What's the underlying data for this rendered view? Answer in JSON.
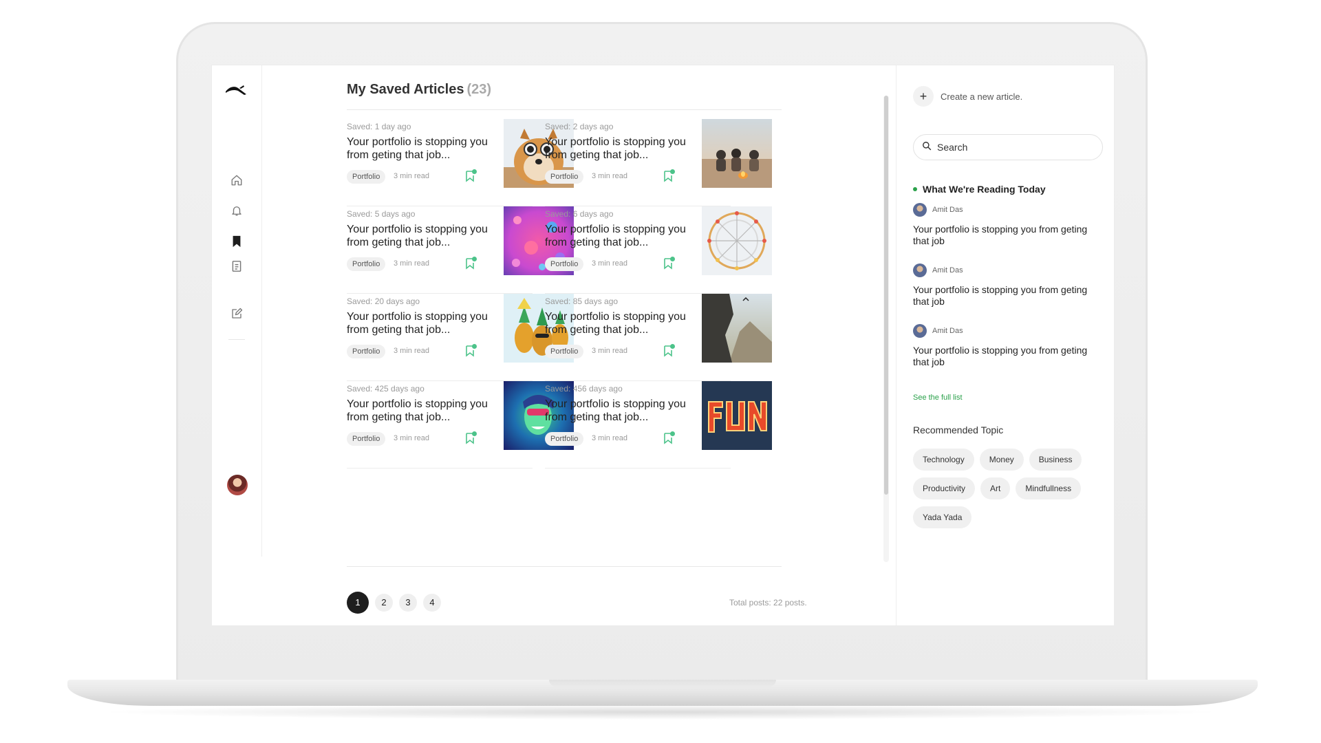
{
  "main": {
    "title": "My Saved Articles",
    "count": "(23)"
  },
  "articles": [
    {
      "saved": "Saved: 1 day ago",
      "title": "Your portfolio is stopping you from geting that job...",
      "tag": "Portfolio",
      "read": "3 min read",
      "image": "dog-with-sunglasses"
    },
    {
      "saved": "Saved: 2 days ago",
      "title": "Your portfolio is stopping you from geting that job...",
      "tag": "Portfolio",
      "read": "3 min read",
      "image": "campfire-beach"
    },
    {
      "saved": "Saved: 5 days ago",
      "title": "Your portfolio is stopping you from geting that job...",
      "tag": "Portfolio",
      "read": "3 min read",
      "image": "pink-glitter"
    },
    {
      "saved": "Saved: 6 days ago",
      "title": "Your portfolio is stopping you from geting that job...",
      "tag": "Portfolio",
      "read": "3 min read",
      "image": "ferris-wheel"
    },
    {
      "saved": "Saved: 20 days ago",
      "title": "Your portfolio is stopping you from geting that job...",
      "tag": "Portfolio",
      "read": "3 min read",
      "image": "party-pineapples"
    },
    {
      "saved": "Saved: 85 days ago",
      "title": "Your portfolio is stopping you from geting that job...",
      "tag": "Portfolio",
      "read": "3 min read",
      "image": "cliff-mountain"
    },
    {
      "saved": "Saved: 425 days ago",
      "title": "Your portfolio is stopping you from geting that job...",
      "tag": "Portfolio",
      "read": "3 min read",
      "image": "neon-woman"
    },
    {
      "saved": "Saved: 456 days ago",
      "title": "Your portfolio is stopping you from geting that job...",
      "tag": "Portfolio",
      "read": "3 min read",
      "image": "fun-marquee-sign"
    }
  ],
  "pagination": {
    "pages": [
      "1",
      "2",
      "3",
      "4"
    ],
    "active": "1",
    "total": "Total posts: 22 posts."
  },
  "sidebar": {
    "create_label": "Create a new article.",
    "search_placeholder": "Search",
    "reading_title": "What We're Reading Today",
    "reading": [
      {
        "author": "Amit Das",
        "title": "Your portfolio is stopping you from geting that job"
      },
      {
        "author": "Amit Das",
        "title": "Your portfolio is stopping you from geting that job"
      },
      {
        "author": "Amit Das",
        "title": "Your portfolio is stopping you from geting that job"
      }
    ],
    "see_full": "See the full list",
    "recommended_title": "Recommended Topic",
    "topics": [
      "Technology",
      "Money",
      "Business",
      "Productivity",
      "Art",
      "Mindfullness",
      "Yada Yada"
    ]
  },
  "nav": {
    "icons": [
      "home-icon",
      "bell-icon",
      "bookmark-icon",
      "document-icon",
      "edit-icon"
    ]
  },
  "colors": {
    "accent_green": "#2aa14a",
    "bookmark_green": "#4cc38a",
    "active_page": "#1e1e1e"
  }
}
